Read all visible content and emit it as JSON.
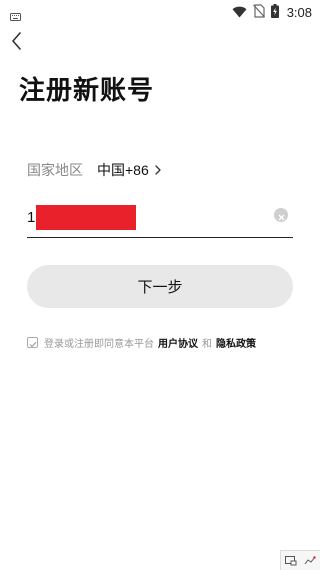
{
  "status_bar": {
    "time": "3:08",
    "icons": [
      "keyboard-icon",
      "wifi-icon",
      "no-sim-icon",
      "battery-charging-icon"
    ]
  },
  "header": {
    "back_icon": "chevron-left-icon",
    "title": "注册新账号"
  },
  "region": {
    "label": "国家地区",
    "country": "中国",
    "code": "+86",
    "chevron_icon": "chevron-right-icon"
  },
  "phone": {
    "value_visible": "1",
    "redacted": true,
    "redaction_color": "#e8212b",
    "clear_icon": "clear-circle-icon"
  },
  "next_button": {
    "label": "下一步",
    "background": "#e8e8e8"
  },
  "agreement": {
    "checked": true,
    "prefix": "登录或注册即同意本平台",
    "user_agreement": "用户协议",
    "and": "和",
    "privacy_policy": "隐私政策"
  },
  "corner_widget": {
    "icons": [
      "screenshot-icon",
      "chart-icon"
    ]
  }
}
